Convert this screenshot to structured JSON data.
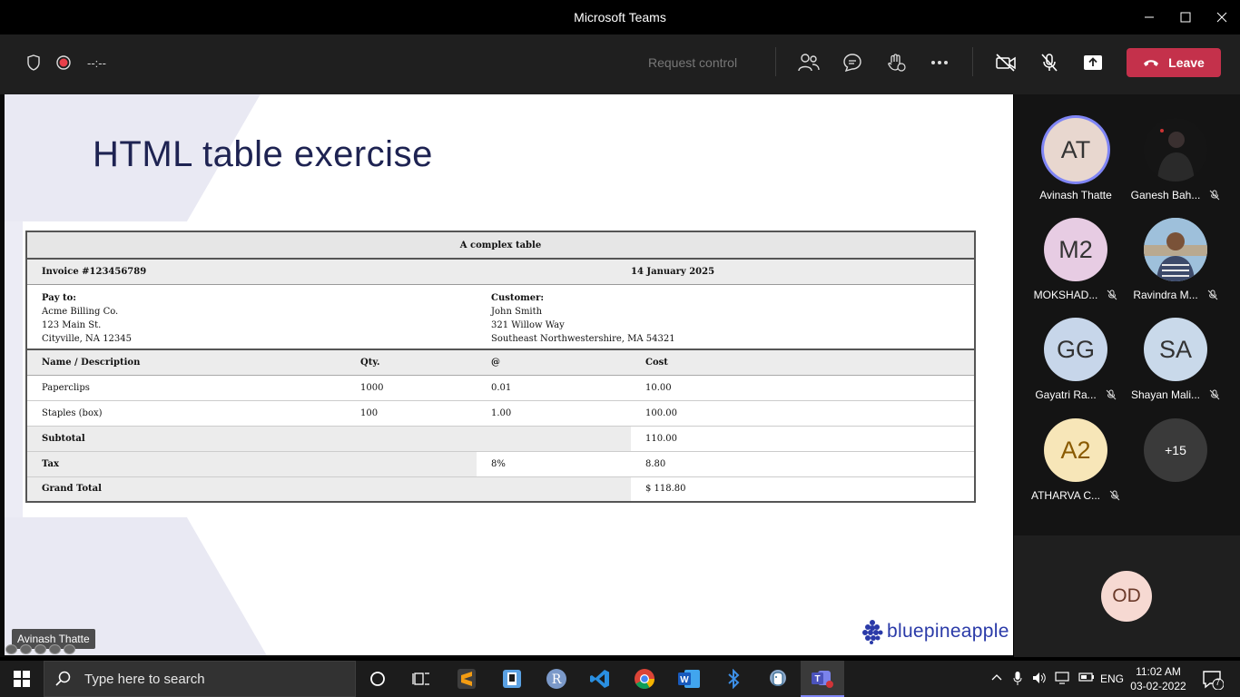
{
  "window": {
    "title": "Microsoft Teams"
  },
  "toolbar": {
    "timer": "--:--",
    "request_control": "Request control",
    "leave_label": "Leave"
  },
  "slide": {
    "title": "HTML table exercise",
    "presenter_label": "Avinash Thatte",
    "logo_text": "bluepineapple",
    "table": {
      "caption": "A complex table",
      "invoice": "Invoice #123456789",
      "date": "14 January 2025",
      "payto": {
        "label": "Pay to:",
        "line1": "Acme Billing Co.",
        "line2": "123 Main St.",
        "line3": "Cityville, NA 12345"
      },
      "customer": {
        "label": "Customer:",
        "line1": "John Smith",
        "line2": "321 Willow Way",
        "line3": "Southeast Northwestershire, MA 54321"
      },
      "headers": [
        "Name / Description",
        "Qty.",
        "@",
        "Cost"
      ],
      "rows": [
        [
          "Paperclips",
          "1000",
          "0.01",
          "10.00"
        ],
        [
          "Staples (box)",
          "100",
          "1.00",
          "100.00"
        ]
      ],
      "subtotal_label": "Subtotal",
      "subtotal_value": "110.00",
      "tax_label": "Tax",
      "tax_rate": "8%",
      "tax_value": "8.80",
      "grand_label": "Grand Total",
      "grand_value": "$ 118.80"
    }
  },
  "participants": [
    {
      "initials": "AT",
      "name": "Avinash Thatte",
      "color": "#e8d7cf",
      "muted": false,
      "speaking": true
    },
    {
      "initials": "",
      "name": "Ganesh Bah...",
      "color": "#222222",
      "muted": true,
      "photo": true
    },
    {
      "initials": "M2",
      "name": "MOKSHAD...",
      "color": "#e7cce3",
      "muted": true
    },
    {
      "initials": "",
      "name": "Ravindra M...",
      "color": "#7aa0c0",
      "muted": true,
      "photo": true
    },
    {
      "initials": "GG",
      "name": "Gayatri Ra...",
      "color": "#c7d6ea",
      "muted": true
    },
    {
      "initials": "SA",
      "name": "Shayan Mali...",
      "color": "#c9d9ea",
      "muted": true
    },
    {
      "initials": "A2",
      "name": "ATHARVA C...",
      "color": "#f7e6b8",
      "muted": true
    },
    {
      "initials": "+15",
      "name": "",
      "color": "#3a3a3a",
      "muted": false
    }
  ],
  "bottom_participant": {
    "initials": "OD",
    "color": "#f6d9d2"
  },
  "taskbar": {
    "search_placeholder": "Type here to search",
    "time": "11:02 AM",
    "date": "03-02-2022",
    "lang": "ENG",
    "notifications": "7"
  }
}
